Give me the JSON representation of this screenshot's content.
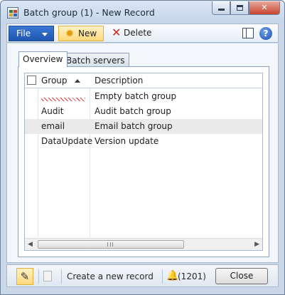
{
  "window": {
    "title": "Batch group (1) - New Record",
    "controls": {
      "close_glyph": "✕"
    }
  },
  "action_pane": {
    "file_label": "File",
    "new_label": "New",
    "delete_label": "Delete",
    "delete_glyph": "✕",
    "new_glyph": "✹",
    "help_glyph": "?"
  },
  "tabs": [
    {
      "label": "Overview",
      "active": true
    },
    {
      "label": "Batch servers",
      "active": false
    }
  ],
  "grid": {
    "columns": [
      "Group",
      "Description"
    ],
    "sort": {
      "column": "Group",
      "direction": "ascending"
    },
    "rows": [
      {
        "group": "",
        "description": "Empty batch group",
        "state": "new-invalid"
      },
      {
        "group": "Audit",
        "description": "Audit batch group",
        "state": "normal"
      },
      {
        "group": "email",
        "description": "Email batch group",
        "state": "selected"
      },
      {
        "group": "DataUpdate",
        "description": "Version update",
        "state": "normal"
      }
    ],
    "scroll": {
      "left_glyph": "◀",
      "right_glyph": "▶"
    }
  },
  "status_bar": {
    "edit_glyph": "✎",
    "message": "Create a new record",
    "notification_count": "(1201)",
    "bell_glyph": "🔔",
    "close_label": "Close"
  }
}
